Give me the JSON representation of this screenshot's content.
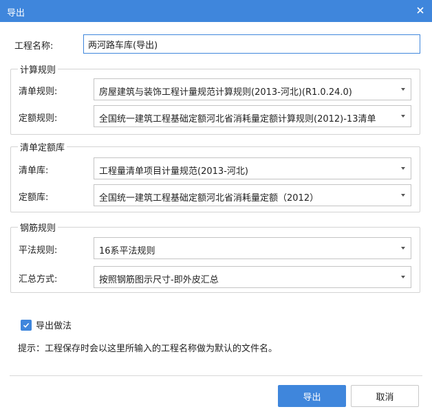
{
  "window": {
    "title": "导出",
    "close_icon": "close-icon"
  },
  "project": {
    "label": "工程名称:",
    "value": "两河路车库(导出)"
  },
  "calc_rules": {
    "legend": "计算规则",
    "bill_rule": {
      "label": "清单规则:",
      "value": "房屋建筑与装饰工程计量规范计算规则(2013-河北)(R1.0.24.0)"
    },
    "quota_rule": {
      "label": "定额规则:",
      "value": "全国统一建筑工程基础定额河北省消耗量定额计算规则(2012)-13清单"
    }
  },
  "libraries": {
    "legend": "清单定额库",
    "bill_lib": {
      "label": "清单库:",
      "value": "工程量清单项目计量规范(2013-河北)"
    },
    "quota_lib": {
      "label": "定额库:",
      "value": "全国统一建筑工程基础定额河北省消耗量定额（2012）"
    }
  },
  "rebar_rules": {
    "legend": "钢筋规则",
    "flat_rule": {
      "label": "平法规则:",
      "value": "16系平法规则"
    },
    "summary_method": {
      "label": "汇总方式:",
      "value": "按照钢筋图示尺寸-即外皮汇总"
    }
  },
  "export_method": {
    "label": "导出做法",
    "checked": true
  },
  "hint": "提示：工程保存时会以这里所输入的工程名称做为默认的文件名。",
  "buttons": {
    "ok": "导出",
    "cancel": "取消"
  },
  "colors": {
    "accent": "#3f86dc",
    "border": "#d3d3d3"
  }
}
